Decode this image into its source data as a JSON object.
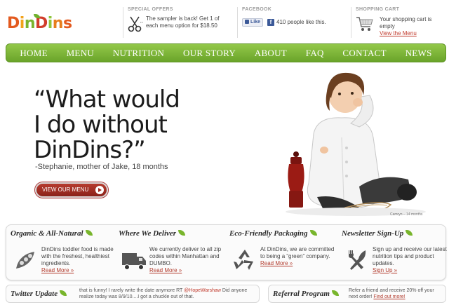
{
  "logo": {
    "parts": [
      "D",
      "i",
      "n",
      "D",
      "i",
      "n",
      "s"
    ]
  },
  "header": {
    "special_offers": {
      "title": "SPECIAL OFFERS",
      "text": "The sampler is back! Get 1 of each menu option for $18.50"
    },
    "facebook": {
      "title": "FACEBOOK",
      "like_label": "Like",
      "fb_logo": "f",
      "count_text": "410 people like this."
    },
    "shopping_cart": {
      "title": "SHOPPING CART",
      "status": "Your shopping cart is empty",
      "link": "View the Menu"
    }
  },
  "nav": {
    "items": [
      "HOME",
      "MENU",
      "NUTRITION",
      "OUR STORY",
      "ABOUT",
      "FAQ",
      "CONTACT",
      "NEWS"
    ]
  },
  "hero": {
    "quote_lines": [
      "“What would",
      "I do without",
      "DinDins?”"
    ],
    "attribution": "-Stephanie, mother of Jake, 18 months",
    "cta": "VIEW OUR MENU",
    "photo_credit": "Camryn – 14 months"
  },
  "features": [
    {
      "title": "Organic & All-Natural",
      "icon": "peapod-icon",
      "text": "DinDins toddler food is made with the freshest, healthiest ingredients.",
      "link": "Read More »"
    },
    {
      "title": "Where We Deliver",
      "icon": "truck-icon",
      "text": "We currently deliver to all zip codes within Manhattan and DUMBO.",
      "link": "Read More »"
    },
    {
      "title": "Eco-Friendly Packaging",
      "icon": "recycle-icon",
      "text": "At DinDins, we are committed to being a “green” company.",
      "link": "Read More »"
    },
    {
      "title": "Newsletter Sign-Up",
      "icon": "fork-knife-icon",
      "text": "Sign up and receive our latest nutrition tips and product updates.",
      "link": "Sign Up »"
    }
  ],
  "twitter": {
    "title": "Twitter Update",
    "text_before": "that is funny! I rarely write the date anymore RT ",
    "handle": "@HopeWarshaw",
    "text_after": " Did anyone realize today was 8/9/10....I got a chuckle out of that."
  },
  "referral": {
    "title": "Referral Program",
    "text": "Refer a friend and receive 20% off your next order! ",
    "link": "Find out more!"
  },
  "colors": {
    "nav_green": "#7ab33a",
    "accent_red": "#a0281d",
    "leaf_green": "#78b52c"
  }
}
